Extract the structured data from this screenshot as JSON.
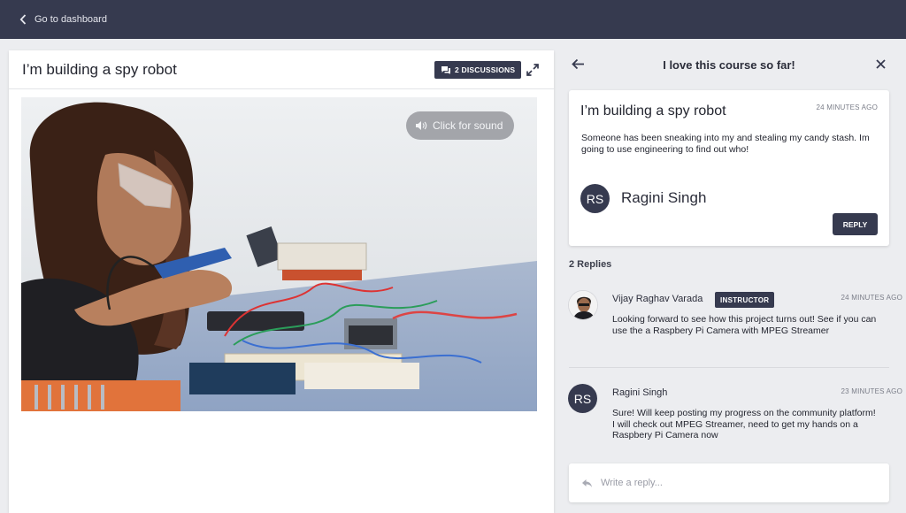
{
  "topbar": {
    "back_label": "Go to dashboard"
  },
  "project": {
    "title": "I’m building a spy robot",
    "discussions_label": "2 DISCUSSIONS",
    "sound_label": "Click for sound"
  },
  "discussion": {
    "header_title": "I love this course so far!",
    "post": {
      "title": "I’m building a spy robot",
      "time": "24 MINUTES AGO",
      "body": "Someone has been sneaking into my and stealing my candy stash. Im going to use engineering to find out who!",
      "author_initials": "RS",
      "author_name": "Ragini Singh",
      "reply_label": "REPLY"
    },
    "replies_count": "2 Replies",
    "replies": [
      {
        "name": "Vijay Raghav Varada",
        "badge": "INSTRUCTOR",
        "time": "24 MINUTES AGO",
        "text": "Looking forward to see how this project turns out! See if you can use the a Raspbery Pi Camera with MPEG Streamer"
      },
      {
        "initials": "RS",
        "name": "Ragini Singh",
        "time": "23 MINUTES AGO",
        "text_line1": "Sure! Will keep posting my progress on the community platform!",
        "text_line2": "I will check out MPEG Streamer, need to get my hands on a Raspbery Pi Camera now"
      }
    ],
    "reply_placeholder": "Write a reply..."
  },
  "colors": {
    "navy": "#363a4f",
    "background": "#ecedf0"
  },
  "icons": {
    "back": "chevron-left-icon",
    "discussions": "chat-bubbles-icon",
    "expand": "expand-arrows-icon",
    "sound": "speaker-icon",
    "panel_back": "arrow-left-icon",
    "panel_close": "close-icon",
    "reply_input": "reply-arrow-icon"
  }
}
